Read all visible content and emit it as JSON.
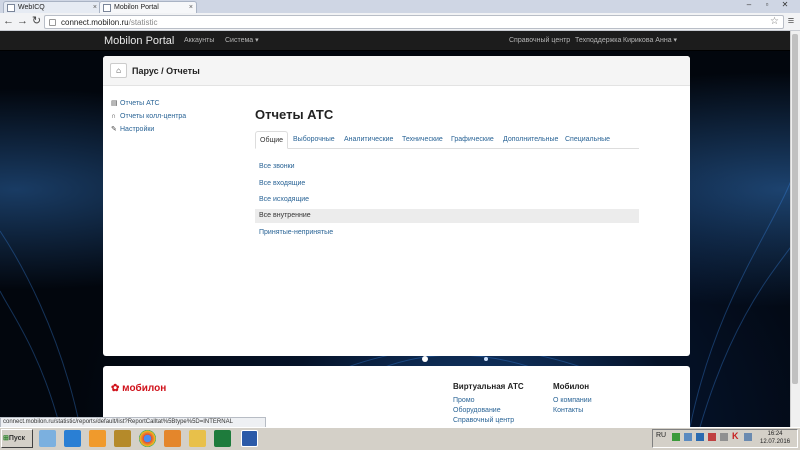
{
  "browser": {
    "tabs": [
      {
        "label": "WebICQ",
        "close": "×"
      },
      {
        "label": "Mobilon Portal",
        "close": "×"
      }
    ],
    "url_host": "connect.mobilon.ru",
    "url_path": "/statistic",
    "status_url": "connect.mobilon.ru/statistic/reports/default/list?ReportCalltat%5Btype%5D=INTERNAL"
  },
  "navbar": {
    "brand": "Mobilon Portal",
    "left_links": [
      "Аккаунты",
      "Система ▾"
    ],
    "right_links": [
      "Справочный центр",
      "Техподдержка",
      "Кирикова Анна ▾"
    ]
  },
  "breadcrumb": "Парус / Отчеты",
  "sidebar": {
    "items": [
      {
        "label": "Отчеты АТС",
        "icon": "report-icon"
      },
      {
        "label": "Отчеты колл-центра",
        "icon": "headset-icon"
      },
      {
        "label": "Настройки",
        "icon": "wrench-icon"
      }
    ]
  },
  "main": {
    "title": "Отчеты АТС",
    "tabs": [
      "Общие",
      "Выборочные",
      "Аналитические",
      "Технические",
      "Графические",
      "Дополнительные",
      "Специальные"
    ],
    "active_tab": "Общие",
    "rows": [
      "Все звонки",
      "Все входящие",
      "Все исходящие",
      "Все внутренние",
      "Принятые-непринятые"
    ],
    "selected_row": "Все внутренние"
  },
  "footer": {
    "logo_text": "мобилон",
    "col1": {
      "title": "Виртуальная АТС",
      "links": [
        "Промо",
        "Оборудование",
        "Справочный центр"
      ]
    },
    "col2": {
      "title": "Мобилон",
      "links": [
        "О компании",
        "Контакты"
      ]
    }
  },
  "taskbar": {
    "start": "Пуск",
    "lang": "RU",
    "time": "16:24",
    "date": "12.07.2016"
  },
  "colors": {
    "link": "#2a6496",
    "navbar": "#1c1c1c",
    "logo": "#d0121b"
  }
}
